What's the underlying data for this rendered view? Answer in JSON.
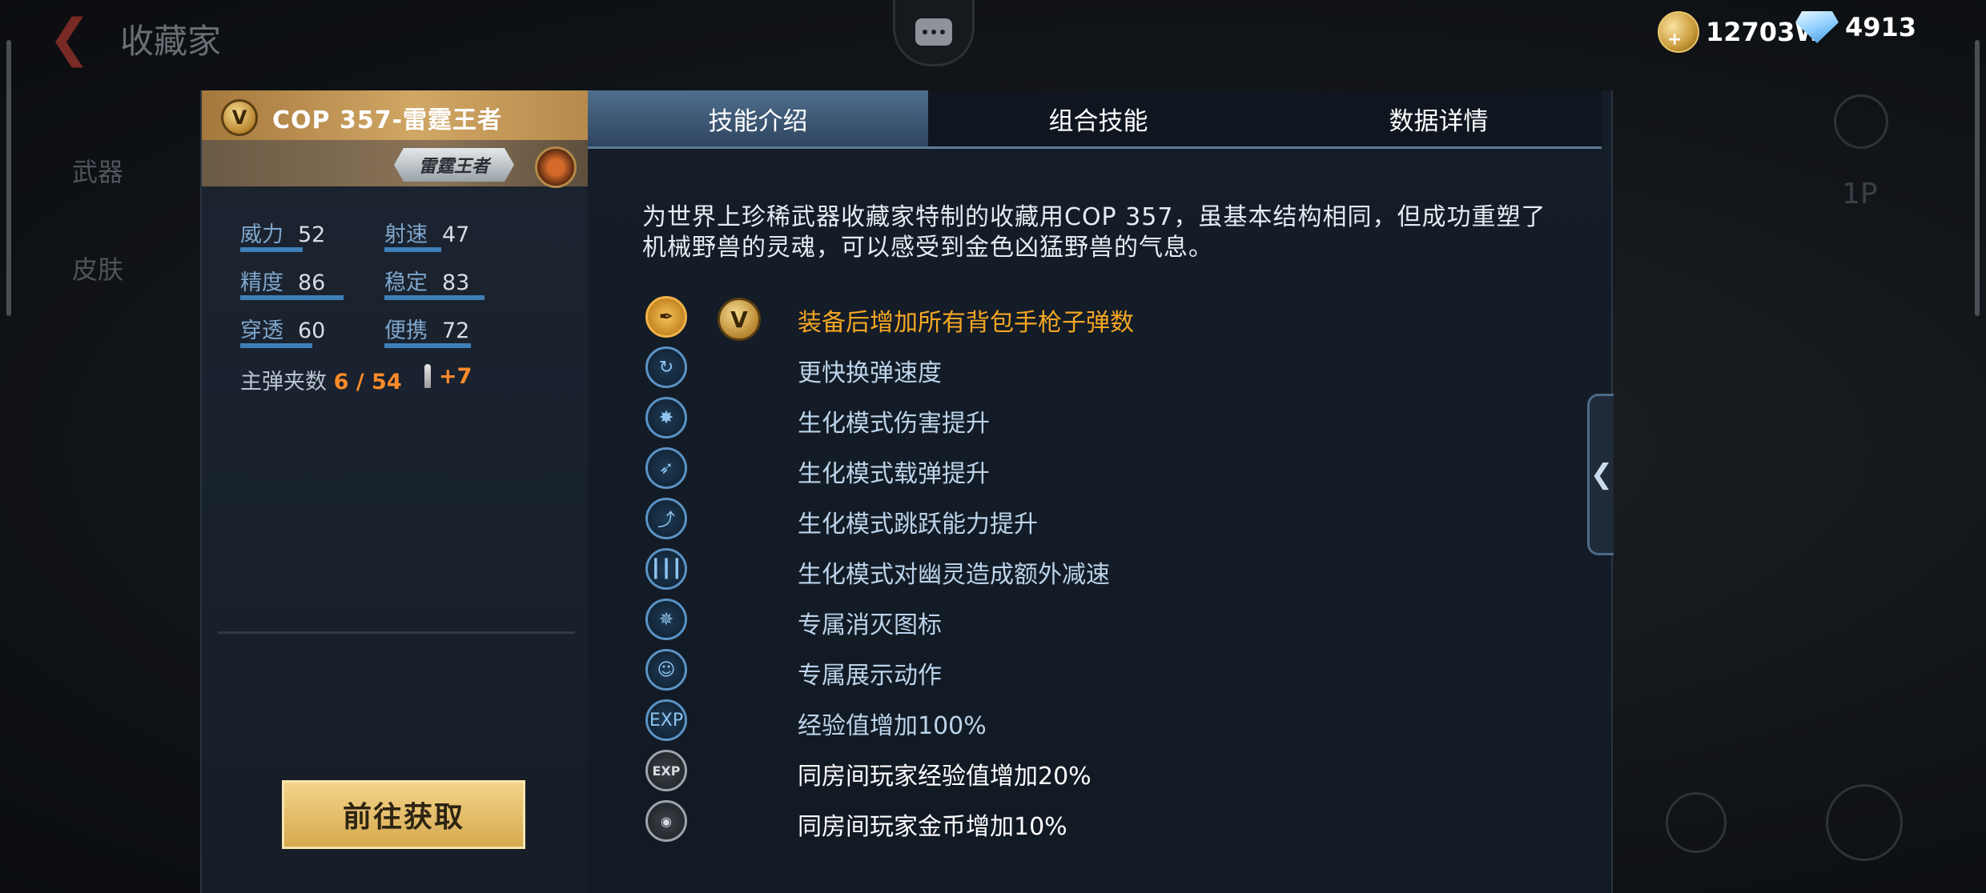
{
  "header": {
    "title": "收藏家",
    "gold": "12703W",
    "diamonds": "4913"
  },
  "side_nav": {
    "weapon": "武器",
    "skin": "皮肤",
    "player": "1P"
  },
  "weapon": {
    "name": "COP 357-雷霆王者",
    "badge_letter": "V",
    "tag": "雷霆王者",
    "stats": [
      {
        "label": "威力",
        "value": "52",
        "fraction": 0.52
      },
      {
        "label": "射速",
        "value": "47",
        "fraction": 0.47
      },
      {
        "label": "精度",
        "value": "86",
        "fraction": 0.86
      },
      {
        "label": "稳定",
        "value": "83",
        "fraction": 0.83
      },
      {
        "label": "穿透",
        "value": "60",
        "fraction": 0.6
      },
      {
        "label": "便携",
        "value": "72",
        "fraction": 0.72
      }
    ],
    "clip_label": "主弹夹数",
    "clip_value": "6 / 54",
    "clip_bonus": "+7",
    "get_button": "前往获取"
  },
  "tabs": [
    "技能介绍",
    "组合技能",
    "数据详情"
  ],
  "active_tab": 0,
  "description": "为世界上珍稀武器收藏家特制的收藏用COP 357，虽基本结构相同，但成功重塑了机械野兽的灵魂，可以感受到金色凶猛野兽的气息。",
  "skills": [
    {
      "text": "装备后增加所有背包手枪子弹数",
      "style": "gold",
      "icon": "pistol-icon",
      "v_badge": true
    },
    {
      "text": "更快换弹速度",
      "style": "blue",
      "icon": "reload-icon"
    },
    {
      "text": "生化模式伤害提升",
      "style": "blue",
      "icon": "damage-icon"
    },
    {
      "text": "生化模式载弹提升",
      "style": "blue",
      "icon": "ammo-gun-icon"
    },
    {
      "text": "生化模式跳跃能力提升",
      "style": "blue",
      "icon": "jump-icon"
    },
    {
      "text": "生化模式对幽灵造成额外减速",
      "style": "blue",
      "icon": "bullets-icon"
    },
    {
      "text": "专属消灭图标",
      "style": "blue",
      "icon": "kill-mark-icon"
    },
    {
      "text": "专属展示动作",
      "style": "blue",
      "icon": "pose-icon"
    },
    {
      "text": "经验值增加100%",
      "style": "blue",
      "icon": "exp-icon"
    },
    {
      "text": "同房间玩家经验值增加20%",
      "style": "white",
      "icon": "room-exp-icon"
    },
    {
      "text": "同房间玩家金币增加10%",
      "style": "white",
      "icon": "room-coin-icon"
    }
  ]
}
